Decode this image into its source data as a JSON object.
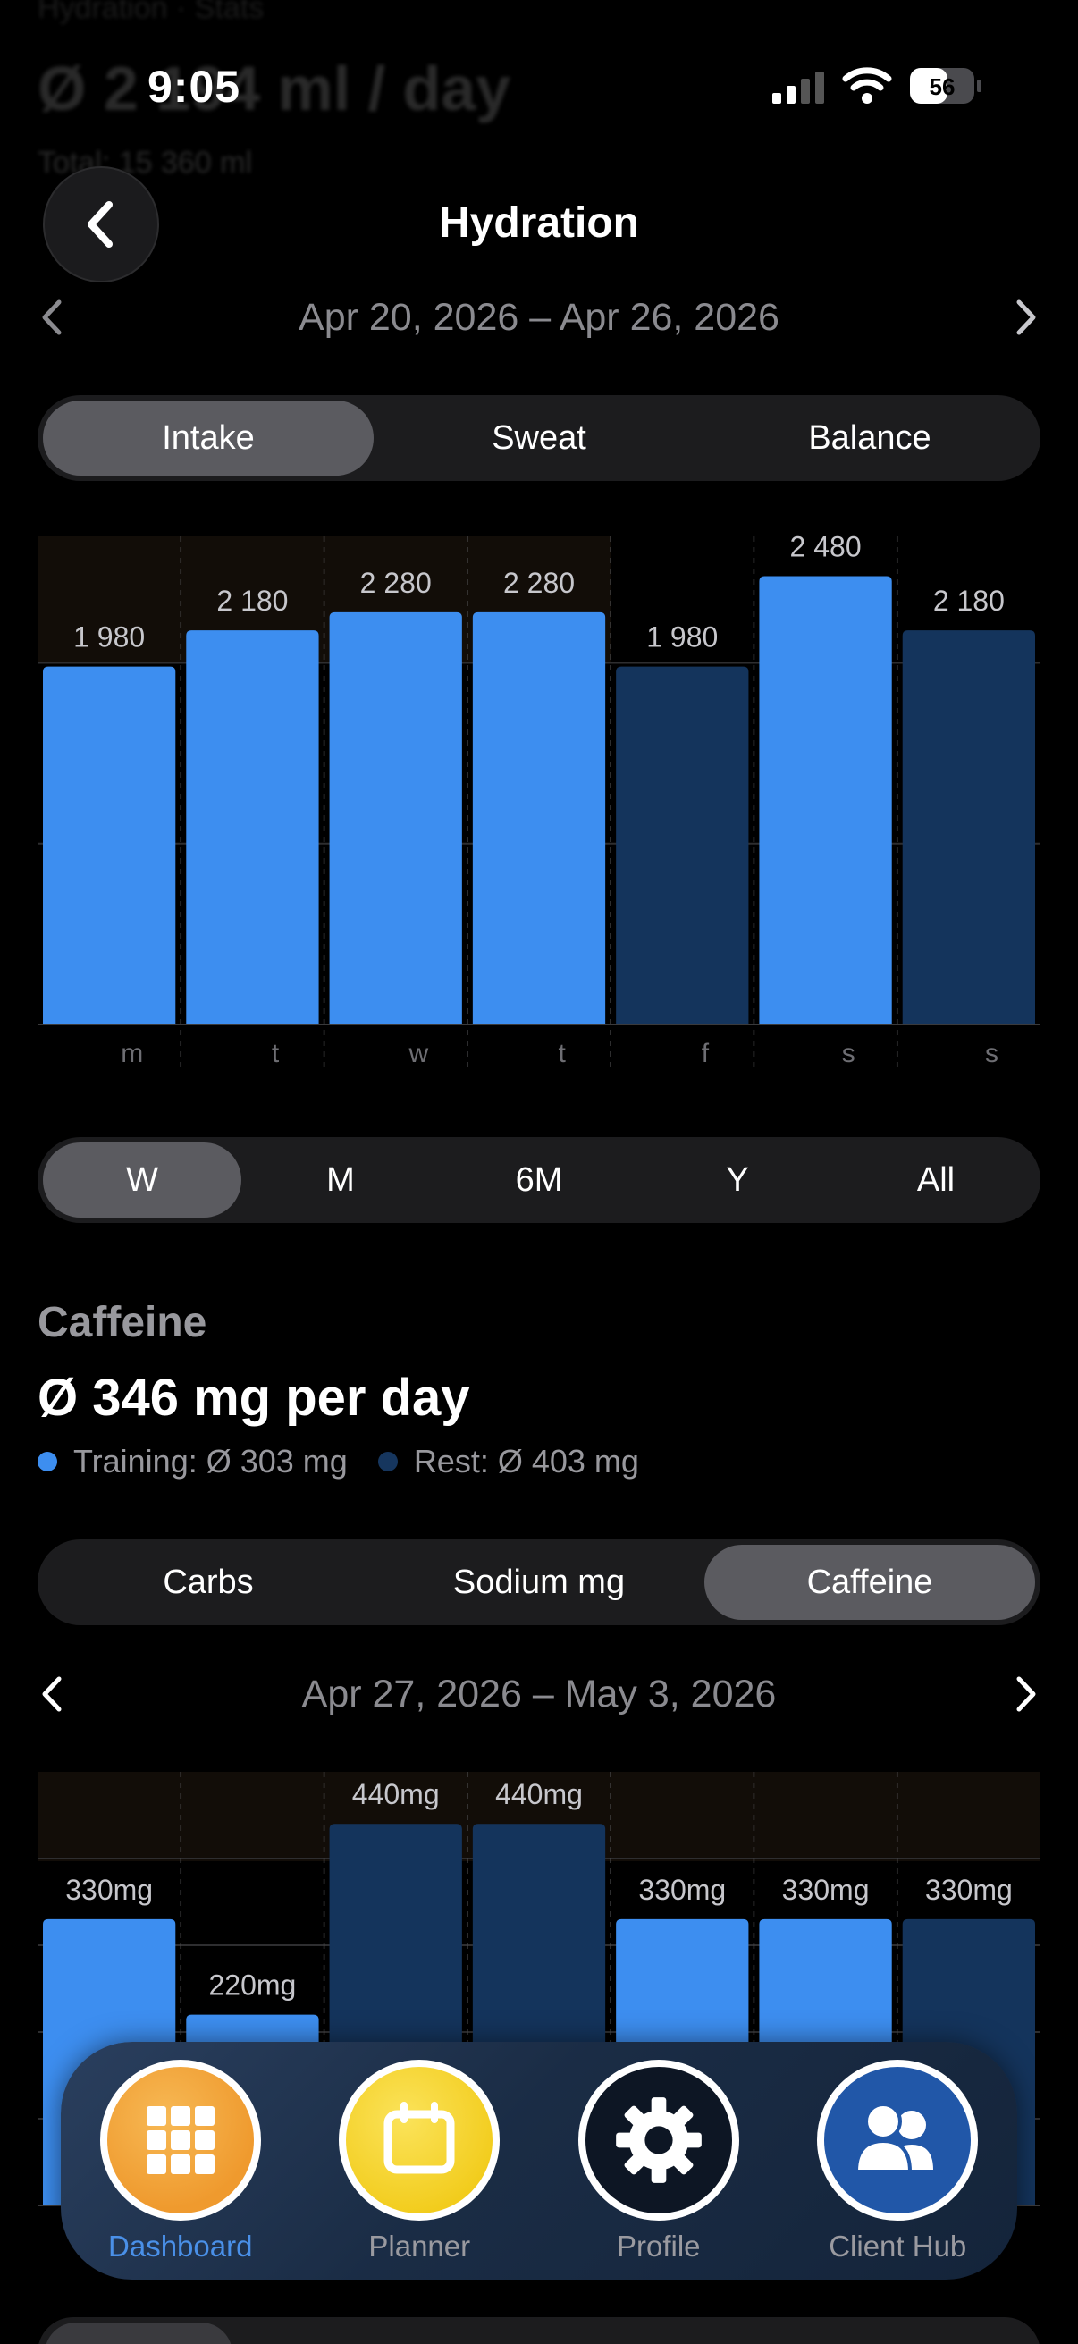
{
  "background_ghost": {
    "line1": "Hydration · Stats",
    "line2": "Ø 2 194 ml / day",
    "line3": "Total: 15 360 ml"
  },
  "status_bar": {
    "time": "9:05",
    "battery": "56"
  },
  "header": {
    "title": "Hydration"
  },
  "hydration": {
    "range_label": "Apr 20, 2026 – Apr 26, 2026",
    "tabs": [
      {
        "label": "Intake",
        "active": true
      },
      {
        "label": "Sweat",
        "active": false
      },
      {
        "label": "Balance",
        "active": false
      }
    ]
  },
  "period_tabs": [
    {
      "label": "W",
      "active": true
    },
    {
      "label": "M",
      "active": false
    },
    {
      "label": "6M",
      "active": false
    },
    {
      "label": "Y",
      "active": false
    },
    {
      "label": "All",
      "active": false
    }
  ],
  "caffeine": {
    "title": "Caffeine",
    "avg": "Ø 346 mg per day",
    "legend": [
      {
        "label": "Training: Ø 303 mg",
        "color": "#3d8ef0"
      },
      {
        "label": "Rest: Ø 403 mg",
        "color": "#16365e"
      }
    ],
    "tabs": [
      {
        "label": "Carbs",
        "active": false
      },
      {
        "label": "Sodium mg",
        "active": false
      },
      {
        "label": "Caffeine",
        "active": true
      }
    ],
    "range_label": "Apr 27, 2026 – May 3, 2026"
  },
  "chart_data": [
    {
      "type": "bar",
      "categories": [
        "m",
        "t",
        "w",
        "t",
        "f",
        "s",
        "s"
      ],
      "values": [
        1980,
        2180,
        2280,
        2280,
        1980,
        2480,
        2180
      ],
      "value_labels": [
        "1 980",
        "2 180",
        "2 280",
        "2 280",
        "1 980",
        "2 480",
        "2 180"
      ],
      "day_type": [
        "training",
        "training",
        "training",
        "training",
        "rest",
        "training",
        "rest"
      ],
      "ylim": [
        0,
        2700
      ],
      "grid": true,
      "colors": {
        "training": "#3d8ef0",
        "rest": "#14345c"
      }
    },
    {
      "type": "bar",
      "categories": [
        "m",
        "t",
        "w",
        "t",
        "f",
        "s",
        "s"
      ],
      "values": [
        330,
        220,
        440,
        440,
        330,
        330,
        330
      ],
      "value_labels": [
        "330mg",
        "220mg",
        "440mg",
        "440mg",
        "330mg",
        "330mg",
        "330mg"
      ],
      "day_type": [
        "training",
        "training",
        "rest",
        "rest",
        "training",
        "training",
        "rest"
      ],
      "ylim": [
        0,
        500
      ],
      "grid": true,
      "colors": {
        "training": "#3d8ef0",
        "rest": "#14345c"
      }
    }
  ],
  "tabbar": {
    "items": [
      {
        "label": "Dashboard",
        "icon": "grid-icon",
        "active": true
      },
      {
        "label": "Planner",
        "icon": "calendar-icon",
        "active": false
      },
      {
        "label": "Profile",
        "icon": "gear-icon",
        "active": false
      },
      {
        "label": "Client Hub",
        "icon": "people-icon",
        "active": false
      }
    ]
  }
}
